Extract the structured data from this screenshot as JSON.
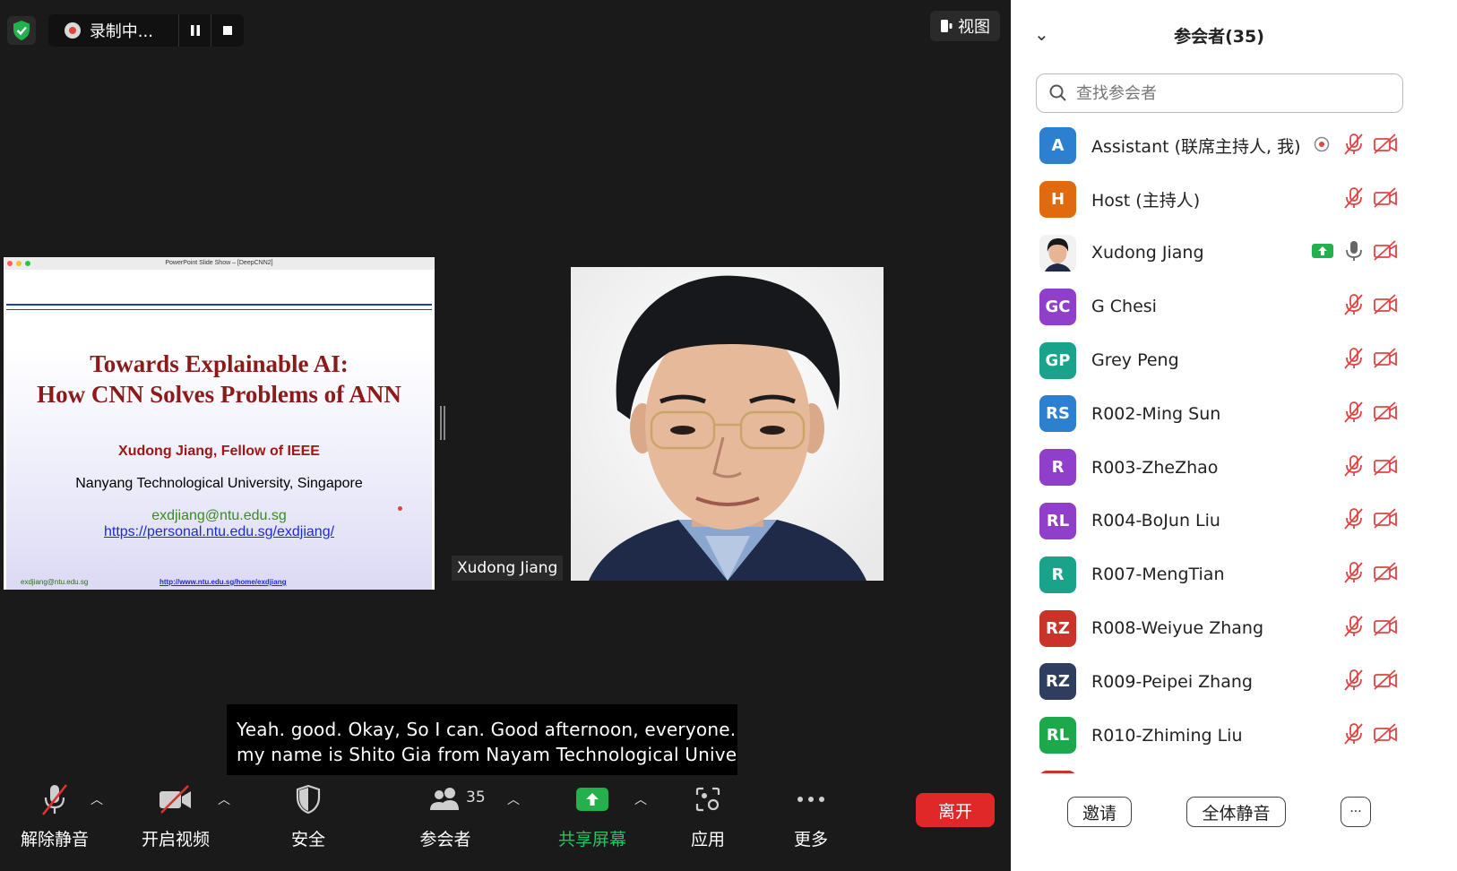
{
  "recording": {
    "label": "录制中..."
  },
  "view_button": {
    "label": "视图"
  },
  "slide": {
    "window_title": "PowerPoint Slide Show – [DeepCNN2]",
    "title_line1": "Towards Explainable AI:",
    "title_line2": "How CNN Solves Problems of ANN",
    "author": "Xudong Jiang, Fellow of IEEE",
    "affiliation": "Nanyang Technological University, Singapore",
    "email": "exdjiang@ntu.edu.sg",
    "url": "https://personal.ntu.edu.sg/exdjiang/",
    "footer_email": "exdjiang@ntu.edu.sg",
    "footer_url": "http://www.ntu.edu.sg/home/exdjiang"
  },
  "video": {
    "name": "Xudong Jiang"
  },
  "caption": {
    "line1": "Yeah. good. Okay, So I can. Good afternoon, everyone. So",
    "line2": "my name is Shito Gia from Nayam Technological Universit"
  },
  "toolbar": {
    "unmute": "解除静音",
    "start_video": "开启视频",
    "security": "安全",
    "participants": "参会者",
    "participants_count": "35",
    "share_screen": "共享屏幕",
    "apps": "应用",
    "more": "更多",
    "leave": "离开"
  },
  "sidebar": {
    "title": "参会者(35)",
    "search_placeholder": "查找参会者",
    "participants": [
      {
        "initials": "A",
        "name": "Assistant (联席主持人, 我)",
        "color": "#2d7fd0"
      },
      {
        "initials": "H",
        "name": "Host (主持人)",
        "color": "#e06a10"
      },
      {
        "initials": "",
        "name": "Xudong Jiang",
        "color": "#ffffff"
      },
      {
        "initials": "GC",
        "name": "G Chesi",
        "color": "#8f3fc9"
      },
      {
        "initials": "GP",
        "name": "Grey Peng",
        "color": "#19a38a"
      },
      {
        "initials": "RS",
        "name": "R002-Ming Sun",
        "color": "#2d7fd0"
      },
      {
        "initials": "R",
        "name": "R003-ZheZhao",
        "color": "#8f3fc9"
      },
      {
        "initials": "RL",
        "name": "R004-BoJun Liu",
        "color": "#8f3fc9"
      },
      {
        "initials": "R",
        "name": "R007-MengTian",
        "color": "#19a38a"
      },
      {
        "initials": "RZ",
        "name": "R008-Weiyue Zhang",
        "color": "#c9332a"
      },
      {
        "initials": "RZ",
        "name": "R009-Peipei Zhang",
        "color": "#2f3e5e"
      },
      {
        "initials": "RL",
        "name": "R010-Zhiming Liu",
        "color": "#1ea84c"
      }
    ],
    "invite": "邀请",
    "mute_all": "全体静音",
    "more": "···"
  }
}
